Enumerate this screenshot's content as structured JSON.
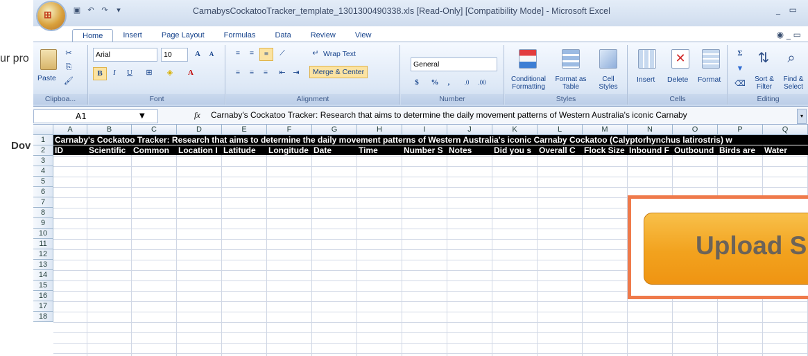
{
  "background": {
    "left_text_1": "ur pro",
    "left_text_2": "Dov"
  },
  "window": {
    "title": "CarnabysCockatooTracker_template_1301300490338.xls  [Read-Only]  [Compatibility Mode] - Microsoft Excel",
    "controls": [
      "_",
      "▭",
      "✕"
    ]
  },
  "ribbon_tabs": [
    "Home",
    "Insert",
    "Page Layout",
    "Formulas",
    "Data",
    "Review",
    "View"
  ],
  "active_tab": "Home",
  "ribbon": {
    "clipboard": {
      "label": "Clipboa...",
      "paste": "Paste"
    },
    "font": {
      "label": "Font",
      "name": "Arial",
      "size": "10",
      "bold": "B",
      "italic": "I",
      "underline": "U"
    },
    "alignment": {
      "label": "Alignment",
      "wrap": "Wrap Text",
      "merge": "Merge & Center"
    },
    "number": {
      "label": "Number",
      "format": "General",
      "currency": "$",
      "percent": "%",
      "comma": ","
    },
    "styles": {
      "label": "Styles",
      "cond": "Conditional Formatting",
      "fmt_table": "Format as Table",
      "cell_styles": "Cell Styles"
    },
    "cells": {
      "label": "Cells",
      "insert": "Insert",
      "delete": "Delete",
      "format": "Format"
    },
    "editing": {
      "label": "Editing",
      "sort": "Sort & Filter",
      "find": "Find & Select"
    }
  },
  "formula_bar": {
    "name_box": "A1",
    "fx": "fx",
    "content": "Carnaby's Cockatoo Tracker: Research that aims to determine the daily movement patterns of Western Australia's iconic Carnaby"
  },
  "columns": [
    "A",
    "B",
    "C",
    "D",
    "E",
    "F",
    "G",
    "H",
    "I",
    "J",
    "K",
    "L",
    "M",
    "N",
    "O",
    "P",
    "Q"
  ],
  "rows": [
    "1",
    "2",
    "3",
    "4",
    "5",
    "6",
    "7",
    "8",
    "9",
    "10",
    "11",
    "12",
    "13",
    "14",
    "15",
    "16",
    "17",
    "18"
  ],
  "row1_text": "Carnaby's Cockatoo Tracker: Research that aims to determine the daily movement patterns of Western Australia's iconic Carnaby Cockatoo (Calyptorhynchus latirostris) w",
  "row2_headers": [
    "ID",
    "Scientific",
    "Common",
    "Location I",
    "Latitude",
    "Longitude",
    "Date",
    "Time",
    "Number S",
    "Notes",
    "Did you s",
    "Overall C",
    "Flock Size",
    "Inbound F",
    "Outbound",
    "Birds are",
    "Water"
  ],
  "upload_button": {
    "label": "Upload Sp"
  }
}
